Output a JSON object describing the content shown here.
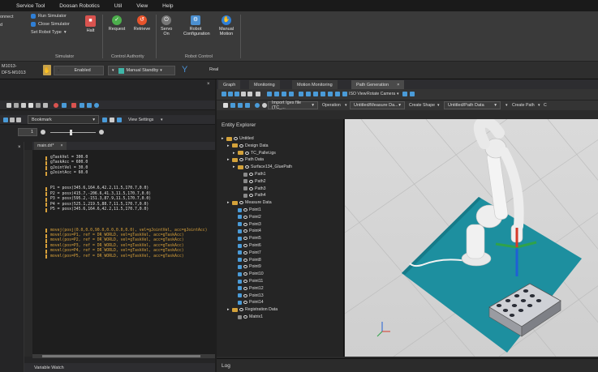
{
  "menu": [
    "Service Tool",
    "Doosan Robotics",
    "Util",
    "View",
    "Help"
  ],
  "ribbon": {
    "left_fragments": [
      "onnect",
      "d"
    ],
    "run_simulator": "Run Simulator",
    "close_simulator": "Close Simulator",
    "set_robot_type": "Set Robot Type",
    "simulator_group": "Simulator",
    "halt": "Halt",
    "request": "Request",
    "retrieve": "Retrieve",
    "control_authority_group": "Control Authority",
    "servo_on": "Servo On",
    "robot_configuration": "Robot Configuration",
    "manual_motion": "Manual Motion",
    "robot_control_group": "Robot Control"
  },
  "statusbar": {
    "model_line1": "M1013-",
    "model_line2": "DFS-M1013",
    "enabled": "Enabled",
    "manual_standby": "Manual Standby",
    "real": "Real"
  },
  "leftpane": {
    "bookmark": "Bookmark",
    "view_settings": "View Settings",
    "line_number": "1",
    "file_tab": "main.drl*",
    "variable_watch": "Variable Watch"
  },
  "code_lines": [
    "gTaskVel = 300.0",
    "gTaskAcc = 600.0",
    "gJointVel = 30.0",
    "gJointAcc = 60.0",
    "",
    "",
    "P1 = posx(345.6,164.6,42.2,11.5,170.7,0.0)",
    "P2 = posx(415.7,-206.6,41.3,11.5,170.7,0.0)",
    "P3 = posx(595.2,-151.3,87.9,11.5,170.7,0.0)",
    "P4 = posx(525.1,219.5,88.7,11.5,170.7,0.0)",
    "P5 = posx(345.6,164.6,42.2,11.5,170.7,0.0)",
    "",
    "",
    "",
    "movej(posj(0.0,0.0,90.0,0.0,0.0,0.0), vel=gJointVel, acc=gJointAcc)",
    "movel(pos=P1, ref = DR_WORLD, vel=gTaskVel, acc=gTaskAcc)",
    "movel(pos=P2, ref = DR_WORLD, vel=gTaskVel, acc=gTaskAcc)",
    "movel(pos=P3, ref = DR_WORLD, vel=gTaskVel, acc=gTaskAcc)",
    "movel(pos=P4, ref = DR_WORLD, vel=gTaskVel, acc=gTaskAcc)",
    "movel(pos=P5, ref = DR_WORLD, vel=gTaskVel, acc=gTaskAcc)"
  ],
  "tabs": [
    "Graph",
    "Monitoring",
    "Motion Monitoring",
    "Path Generation"
  ],
  "view_toolbar": {
    "iso_view": "ISO View",
    "rotate_camera": "Rotate Camera"
  },
  "path_toolbar": {
    "import_file": "Import Iges file (TC_...",
    "operation": "Operation",
    "measure_data": "Untitled/Measure Da...",
    "create_shape": "Create Shape",
    "path_data": "Untitled/Path Data",
    "create_path": "Create Path",
    "trailing": "C"
  },
  "explorer": {
    "title": "Entity Explorer",
    "tree": [
      {
        "label": "Untitled",
        "indent": 0,
        "kind": "folder"
      },
      {
        "label": "Design Data",
        "indent": 1,
        "kind": "folder"
      },
      {
        "label": "TC_Pallet.igs",
        "indent": 2,
        "kind": "folder"
      },
      {
        "label": "Path Data",
        "indent": 1,
        "kind": "folder"
      },
      {
        "label": "Surface134_GluePath",
        "indent": 2,
        "kind": "folder"
      },
      {
        "label": "Path1",
        "indent": 3,
        "kind": "path"
      },
      {
        "label": "Path2",
        "indent": 3,
        "kind": "path"
      },
      {
        "label": "Path3",
        "indent": 3,
        "kind": "path"
      },
      {
        "label": "Path4",
        "indent": 3,
        "kind": "path"
      },
      {
        "label": "Measure Data",
        "indent": 1,
        "kind": "folder"
      },
      {
        "label": "Point1",
        "indent": 2,
        "kind": "point"
      },
      {
        "label": "Point2",
        "indent": 2,
        "kind": "point"
      },
      {
        "label": "Point3",
        "indent": 2,
        "kind": "point"
      },
      {
        "label": "Point4",
        "indent": 2,
        "kind": "point"
      },
      {
        "label": "Point5",
        "indent": 2,
        "kind": "point"
      },
      {
        "label": "Point6",
        "indent": 2,
        "kind": "point"
      },
      {
        "label": "Point7",
        "indent": 2,
        "kind": "point"
      },
      {
        "label": "Point8",
        "indent": 2,
        "kind": "point"
      },
      {
        "label": "Point9",
        "indent": 2,
        "kind": "point"
      },
      {
        "label": "Point10",
        "indent": 2,
        "kind": "point"
      },
      {
        "label": "Point11",
        "indent": 2,
        "kind": "point"
      },
      {
        "label": "Point12",
        "indent": 2,
        "kind": "point"
      },
      {
        "label": "Point13",
        "indent": 2,
        "kind": "point"
      },
      {
        "label": "Point14",
        "indent": 2,
        "kind": "point"
      },
      {
        "label": "Registration Data",
        "indent": 1,
        "kind": "folder"
      },
      {
        "label": "Matrix1",
        "indent": 2,
        "kind": "matrix"
      }
    ]
  },
  "log_title": "Log",
  "colors": {
    "accent": "#2f7fd6",
    "plate": "#1d8f9f",
    "folder": "#d4a23a",
    "point": "#4a9bd8"
  }
}
